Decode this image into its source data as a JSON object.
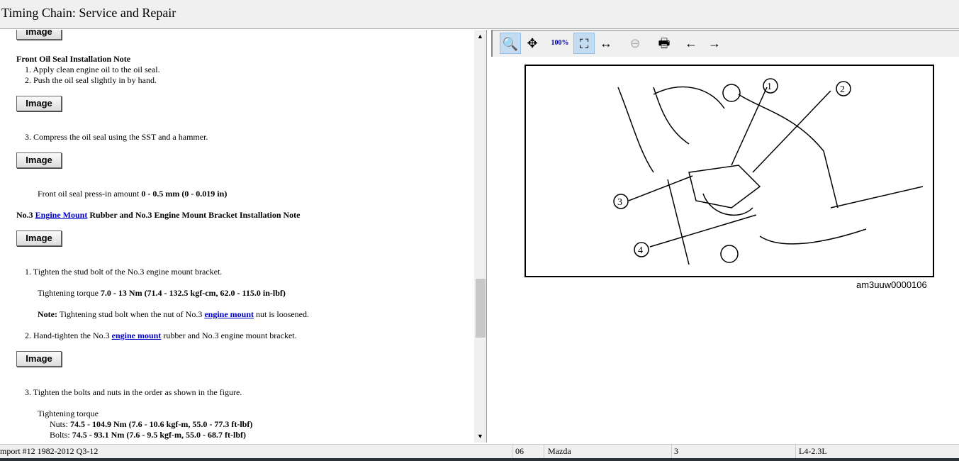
{
  "window": {
    "title": "Timing Chain:  Service and Repair"
  },
  "doc": {
    "btn_label": "Image",
    "front_seal_heading": "Front Oil Seal Installation Note",
    "front_steps": [
      "1.  Apply clean engine oil to the oil seal.",
      "2.  Push the oil seal slightly in by hand.",
      "3.  Compress the oil seal using the SST and a hammer."
    ],
    "press_in_label": "Front oil seal press-in amount ",
    "press_in_value": "0 - 0.5 mm (0 - 0.019 in)",
    "mount_heading_pre": "No.3 ",
    "mount_heading_link": "Engine Mount",
    "mount_heading_post": " Rubber and No.3 Engine Mount Bracket Installation Note",
    "step1": "1.  Tighten the stud bolt of the No.3 engine mount bracket.",
    "torque1_label": "Tightening torque ",
    "torque1_value": "7.0 - 13 Nm (71.4 - 132.5 kgf-cm, 62.0 - 115.0 in-lbf)",
    "note_label": "Note:",
    "note_pre": " Tightening stud bolt when the nut of No.3 ",
    "note_link": "engine mount",
    "note_post": " nut is loosened.",
    "step2_pre": "2.  Hand-tighten the No.3 ",
    "step2_link": "engine mount",
    "step2_post": " rubber and No.3 engine mount bracket.",
    "step3": "3.  Tighten the bolts and nuts in the order as shown in the figure.",
    "torque2_label": "Tightening torque",
    "nuts_label": "Nuts: ",
    "nuts_value": "74.5 - 104.9 Nm (7.6 - 10.6 kgf-m, 55.0 - 77.3 ft-lbf)",
    "bolts_label": "Bolts: ",
    "bolts_value": "74.5 - 93.1 Nm (7.6 - 9.5 kgf-m, 55.0 - 68.7 ft-lbf)"
  },
  "viewer": {
    "figure_id": "am3uuw0000106",
    "callouts": [
      "1",
      "2",
      "3",
      "4"
    ],
    "zoom_100_label": "100%"
  },
  "status": {
    "source": "mport #12 1982-2012 Q3-12",
    "field2": "06",
    "make": "Mazda",
    "field4": "3",
    "engine": "L4-2.3L"
  }
}
